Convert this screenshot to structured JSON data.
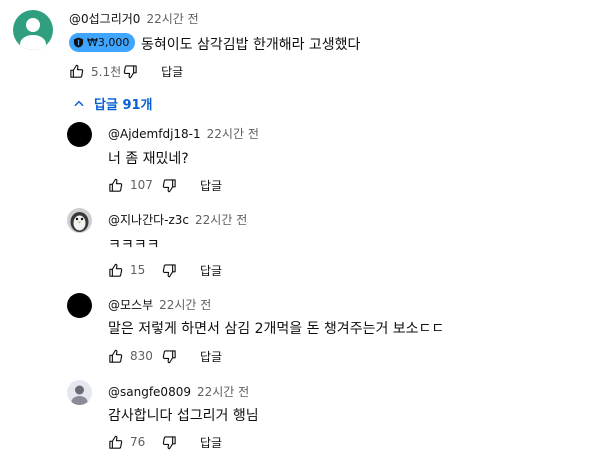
{
  "comment": {
    "author": "@0섭그리거0",
    "time": "22시간 전",
    "badge": "₩3,000",
    "text": "동혀이도 삼각김밥 한개해라 고생했다",
    "likes": "5.1천",
    "reply_label": "답글"
  },
  "replies_toggle": {
    "label": "답글 91개"
  },
  "replies": [
    {
      "author": "@Ajdemfdj18-1",
      "time": "22시간 전",
      "text": "너 좀 재밌네?",
      "likes": "107",
      "reply_label": "답글"
    },
    {
      "author": "@지나간다-z3c",
      "time": "22시간 전",
      "text": "ㅋㅋㅋㅋ",
      "likes": "15",
      "reply_label": "답글"
    },
    {
      "author": "@모스부",
      "time": "22시간 전",
      "text": "말은 저렇게 하면서 삼김 2개먹을 돈 챙겨주는거 보소ㄷㄷ",
      "likes": "830",
      "reply_label": "답글"
    },
    {
      "author": "@sangfe0809",
      "time": "22시간 전",
      "text": "감사합니다 섭그리거 행님",
      "likes": "76",
      "reply_label": "답글"
    }
  ],
  "colors": {
    "badge": "#3ea6ff",
    "link": "#065fd4",
    "avatar_top": "#2f9f7f"
  }
}
